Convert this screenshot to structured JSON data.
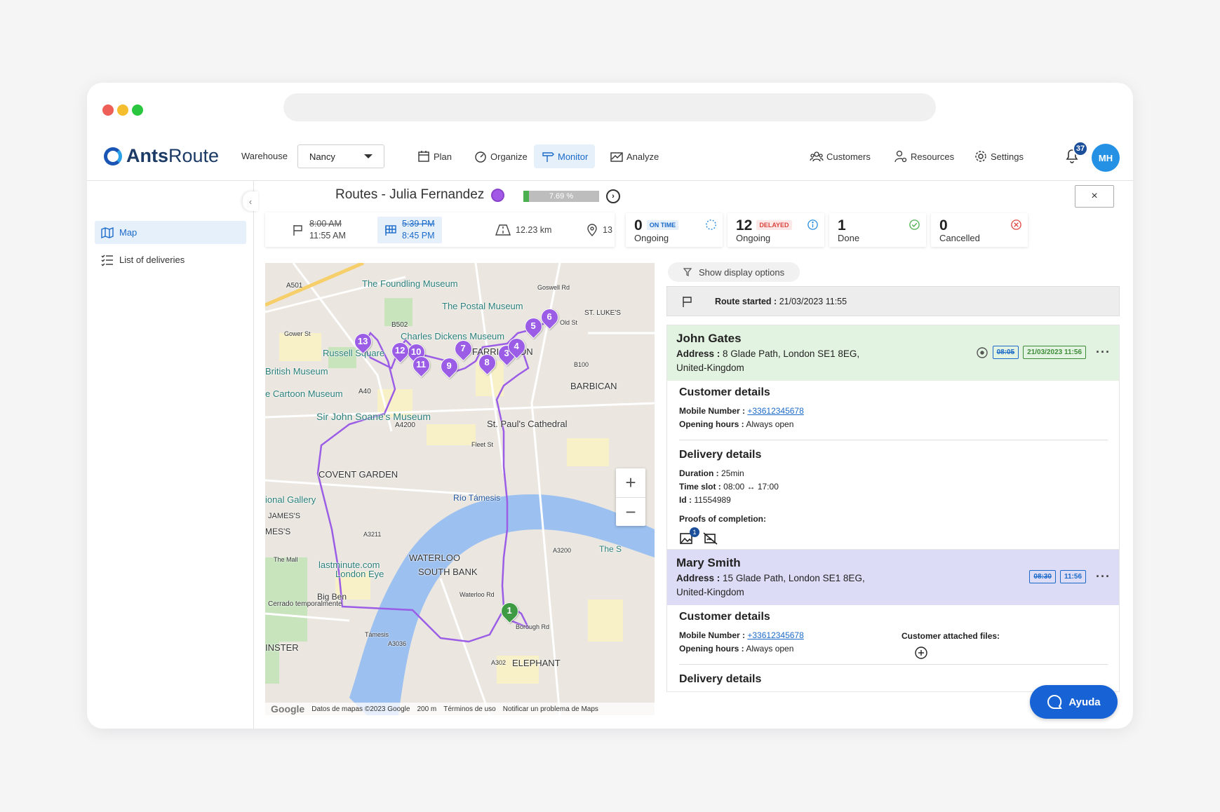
{
  "app": {
    "logo_bold": "Ants",
    "logo_light": "Route"
  },
  "warehouse": {
    "label": "Warehouse",
    "value": "Nancy"
  },
  "nav": [
    {
      "label": "Plan",
      "icon": "calendar-icon"
    },
    {
      "label": "Organize",
      "icon": "gauge-icon"
    },
    {
      "label": "Monitor",
      "icon": "signpost-icon",
      "active": true
    },
    {
      "label": "Analyze",
      "icon": "chart-icon"
    },
    {
      "label": "Customers",
      "icon": "people-icon"
    },
    {
      "label": "Resources",
      "icon": "resource-gear-icon"
    },
    {
      "label": "Settings",
      "icon": "gear-icon"
    }
  ],
  "notifications": {
    "count": "37"
  },
  "user": {
    "initials": "MH"
  },
  "sidebar": {
    "items": [
      {
        "label": "Map",
        "icon": "map-icon",
        "active": true
      },
      {
        "label": "List of deliveries",
        "icon": "list-icon"
      }
    ]
  },
  "route": {
    "title": "Routes - Julia Fernandez",
    "color": "#a259e6",
    "progress_label": "7.69 %",
    "progress": 0.0769,
    "close_label": "×",
    "start_planned": "8:00 AM",
    "start_actual": "11:55 AM",
    "end_planned": "5:39 PM",
    "end_actual": "8:45 PM",
    "distance": "12.23 km",
    "stops": "13"
  },
  "status_cards": [
    {
      "num": "0",
      "tag": "ON TIME",
      "label": "Ongoing",
      "tag_color": "#1b6ac9",
      "tag_bg": "#e6f0fb"
    },
    {
      "num": "12",
      "tag": "DELAYED",
      "label": "Ongoing",
      "tag_color": "#d9453f",
      "tag_bg": "#fde8e7"
    },
    {
      "num": "1",
      "tag": "",
      "label": "Done"
    },
    {
      "num": "0",
      "tag": "",
      "label": "Cancelled"
    }
  ],
  "display_options": "Show display options",
  "route_started": {
    "label": "Route started :",
    "value": "21/03/2023 11:55"
  },
  "deliveries": [
    {
      "name": "John Gates",
      "address_label": "Address :",
      "address_line1": "8 Glade Path, London SE1 8EG,",
      "address_line2": "United-Kingdom",
      "planned_time": "08:05",
      "actual_time": "21/03/2023 11:56",
      "bg": "#e3f3e1",
      "customer_title": "Customer details",
      "mobile_label": "Mobile Number :",
      "mobile": "+33612345678",
      "hours_label": "Opening hours :",
      "hours": "Always open",
      "delivery_title": "Delivery details",
      "duration_label": "Duration :",
      "duration": "25min",
      "slot_label": "Time slot :",
      "slot": "08:00 ↔ 17:00",
      "id_label": "Id :",
      "id": "11554989",
      "proofs_label": "Proofs of completion:",
      "proof_count": "1"
    },
    {
      "name": "Mary Smith",
      "address_label": "Address :",
      "address_line1": "15 Glade Path, London SE1 8EG,",
      "address_line2": "United-Kingdom",
      "planned_time": "08:30",
      "actual_time": "11:56",
      "bg": "#dcdcf6",
      "customer_title": "Customer details",
      "mobile_label": "Mobile Number :",
      "mobile": "+33612345678",
      "hours_label": "Opening hours :",
      "hours": "Always open",
      "files_label": "Customer attached files:",
      "delivery_title": "Delivery details"
    }
  ],
  "map": {
    "labels": [
      "The Foundling Museum",
      "The Postal Museum",
      "Charles Dickens Museum",
      "Russell Square",
      "British Museum",
      "e Cartoon Museum",
      "Sir John Soane's Museum",
      "St. Paul's Cathedral",
      "BARBICAN",
      "COVENT GARDEN",
      "ional Gallery",
      "JAMES'S",
      "MES'S",
      "Río Támesis",
      "WATERLOO",
      "SOUTH BANK",
      "lastminute.com",
      "London Eye",
      "Big Ben",
      "Cerrado temporalmente",
      "INSTER",
      "ELEPHANT",
      "ST. LUKE'S",
      "FARRINGDON",
      "Borough Rd",
      "The S",
      "A501",
      "B502",
      "A40",
      "A4200",
      "A3200",
      "Fleet St",
      "Gower St",
      "Old St",
      "B100",
      "Támesis",
      "The Mall",
      "Waterloo Rd",
      "A3036",
      "A302",
      "A3211",
      "Goswell Rd"
    ],
    "footer": [
      "Datos de mapas ©2023 Google",
      "200 m",
      "Términos de uso",
      "Notificar un problema de Maps"
    ],
    "google": "Google",
    "markers": [
      "1",
      "3",
      "4",
      "5",
      "6",
      "7",
      "8",
      "9",
      "10",
      "11",
      "12",
      "13"
    ]
  },
  "help": {
    "label": "Ayuda"
  }
}
